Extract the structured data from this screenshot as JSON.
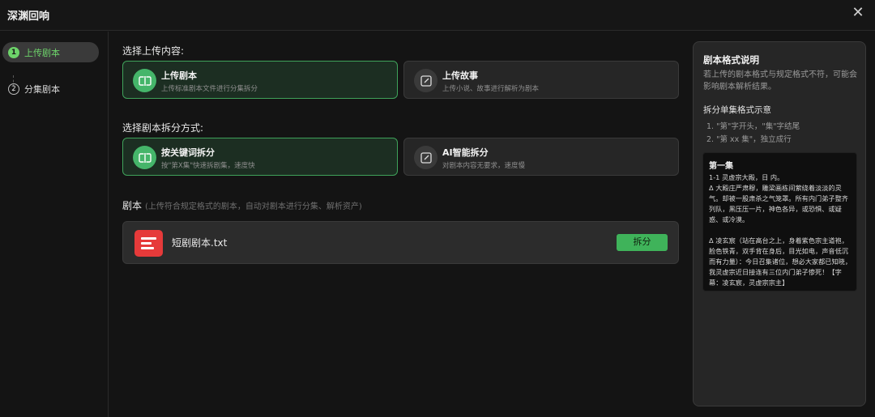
{
  "window": {
    "title": "深渊回响",
    "close_glyph": "✕"
  },
  "sidebar": {
    "steps": [
      {
        "num": "1",
        "label": "上传剧本"
      },
      {
        "num": "2",
        "label": "分集剧本"
      }
    ]
  },
  "upload": {
    "label": "选择上传内容:",
    "options": [
      {
        "title": "上传剧本",
        "subtitle": "上传标准剧本文件进行分集拆分",
        "icon": "script-upload-icon"
      },
      {
        "title": "上传故事",
        "subtitle": "上传小说、故事进行解析为剧本",
        "icon": "edit-document-icon"
      }
    ]
  },
  "split": {
    "label": "选择剧本拆分方式:",
    "options": [
      {
        "title": "按关键词拆分",
        "subtitle": "按\"第X集\"快速拆剧集，速度快",
        "icon": "split-keyword-icon"
      },
      {
        "title": "AI智能拆分",
        "subtitle": "对剧本内容无要求，速度慢",
        "icon": "ai-edit-icon"
      }
    ]
  },
  "script": {
    "label": "剧本",
    "hint": "(上传符合规定格式的剧本，自动对剧本进行分集、解析资产)",
    "file_name": "短剧剧本.txt",
    "split_button": "拆分"
  },
  "format_panel": {
    "title": "剧本格式说明",
    "description": "若上传的剧本格式与规定格式不符，可能会影响剧本解析结果。",
    "subtitle": "拆分单集格式示意",
    "rules": [
      "1. \"第\"字开头，\"集\"字结尾",
      "2. \"第 xx 集\"，独立成行"
    ],
    "sample_title": "第一集",
    "sample_body": "1-1 灵虚宗大殿，日 内。\nΔ 大殿庄严肃穆，雕梁画栋间萦绕着淡淡的灵气。却被一股肃杀之气笼罩。所有内门弟子整齐列队，黑压压一片，神色各异，或恐惧、或疑惑、或冷漠。\n\nΔ 凌玄宸（站在高台之上，身着紫色宗主道袍，脸色铁青，双手背在身后，目光如电，声音低沉而有力量）：今日召集诸位，想必大家都已知晓，我灵虚宗近日接连有三位内门弟子惨死！【字幕：凌玄宸，灵虚宗宗主】"
  },
  "colors": {
    "accent_green": "#6dd36a",
    "button_green": "#3fb35a",
    "file_red": "#e63a3a"
  }
}
